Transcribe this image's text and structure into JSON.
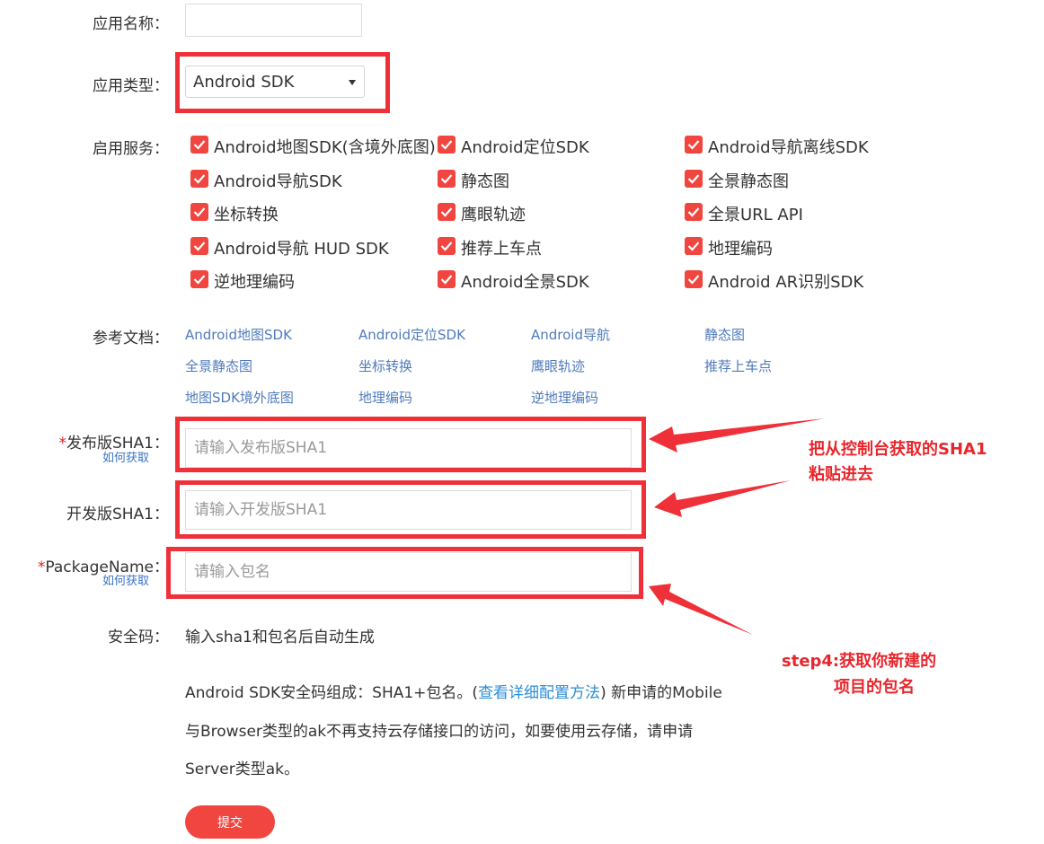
{
  "form": {
    "app_name": {
      "label": "应用名称：",
      "value": ""
    },
    "app_type": {
      "label": "应用类型：",
      "selected": "Android SDK"
    },
    "services": {
      "label": "启用服务：",
      "items": [
        [
          "Android地图SDK(含境外底图)",
          "Android定位SDK",
          "Android导航离线SDK"
        ],
        [
          "Android导航SDK",
          "静态图",
          "全景静态图"
        ],
        [
          "坐标转换",
          "鹰眼轨迹",
          "全景URL API"
        ],
        [
          "Android导航 HUD SDK",
          "推荐上车点",
          "地理编码"
        ],
        [
          "逆地理编码",
          "Android全景SDK",
          "Android AR识别SDK"
        ]
      ]
    },
    "docs": {
      "label": "参考文档：",
      "links": [
        [
          "Android地图SDK",
          "Android定位SDK",
          "Android导航",
          "静态图"
        ],
        [
          "全景静态图",
          "坐标转换",
          "鹰眼轨迹",
          "推荐上车点"
        ],
        [
          "地图SDK境外底图",
          "地理编码",
          "逆地理编码"
        ]
      ]
    },
    "release_sha1": {
      "required_mark": "*",
      "label": "发布版SHA1：",
      "help_link": "如何获取",
      "placeholder": "请输入发布版SHA1"
    },
    "dev_sha1": {
      "label": "开发版SHA1：",
      "placeholder": "请输入开发版SHA1"
    },
    "package_name": {
      "required_mark": "*",
      "label": "PackageName：",
      "help_link": "如何获取",
      "placeholder": "请输入包名"
    },
    "security_code": {
      "label": "安全码：",
      "value": "输入sha1和包名后自动生成"
    },
    "note": {
      "line1_pre": "Android SDK安全码组成：SHA1+包名。(",
      "line1_link": "查看详细配置方法",
      "line1_post": ") 新申请的Mobile",
      "line2": "与Browser类型的ak不再支持云存储接口的访问，如要使用云存储，请申请",
      "line3": "Server类型ak。"
    },
    "submit_label": "提交"
  },
  "annotations": {
    "sha1_note_line1": "把从控制台获取的SHA1",
    "sha1_note_line2": "粘贴进去",
    "package_note_line1": "step4:获取你新建的",
    "package_note_line2": "项目的包名"
  },
  "colors": {
    "highlight_red": "#ef3038",
    "checkbox_red": "#f1463f",
    "link_blue": "#4f7bbd",
    "annotation_red": "#e8262c"
  }
}
